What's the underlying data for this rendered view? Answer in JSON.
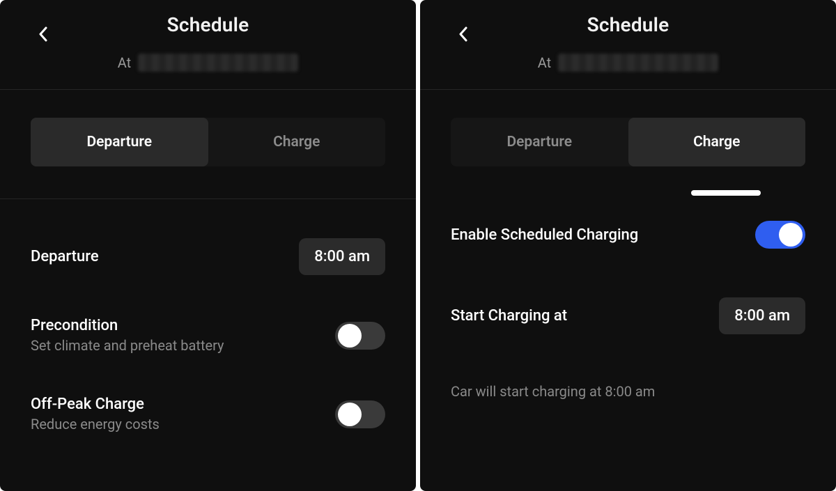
{
  "left": {
    "title": "Schedule",
    "location_prefix": "At",
    "tabs": {
      "departure": "Departure",
      "charge": "Charge",
      "active": "departure"
    },
    "departure": {
      "label": "Departure",
      "time": "8:00 am"
    },
    "precondition": {
      "label": "Precondition",
      "sublabel": "Set climate and preheat battery",
      "on": false
    },
    "offpeak": {
      "label": "Off-Peak Charge",
      "sublabel": "Reduce energy costs",
      "on": false
    }
  },
  "right": {
    "title": "Schedule",
    "location_prefix": "At",
    "tabs": {
      "departure": "Departure",
      "charge": "Charge",
      "active": "charge"
    },
    "enable": {
      "label": "Enable Scheduled Charging",
      "on": true
    },
    "start": {
      "label": "Start Charging at",
      "time": "8:00 am"
    },
    "hint": "Car will start charging at 8:00 am"
  }
}
